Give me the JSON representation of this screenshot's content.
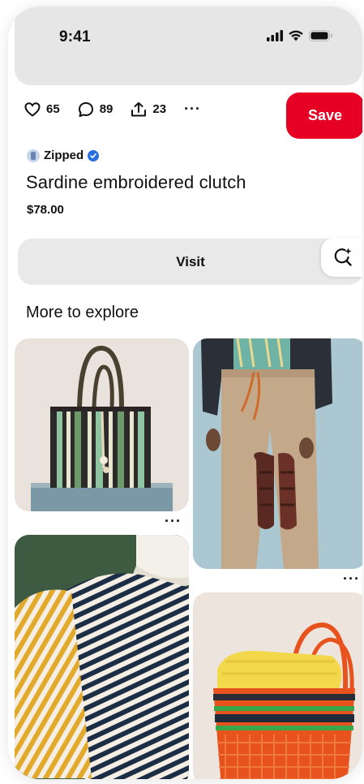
{
  "status_bar": {
    "time": "9:41"
  },
  "actions": {
    "likes": "65",
    "comments": "89",
    "shares": "23",
    "more": "···",
    "save_label": "Save"
  },
  "pin": {
    "brand": "Zipped",
    "title": "Sardine embroidered clutch",
    "price": "$78.00"
  },
  "visit_label": "Visit",
  "explore": {
    "title": "More to explore",
    "card_more": "···"
  },
  "colors": {
    "save": "#e60023",
    "visit_bg": "#e9e9e9",
    "verified": "#2a6fe0"
  },
  "icons": {
    "heart": "heart-icon",
    "comment": "comment-icon",
    "share": "share-icon",
    "lens": "visual-search-icon"
  }
}
